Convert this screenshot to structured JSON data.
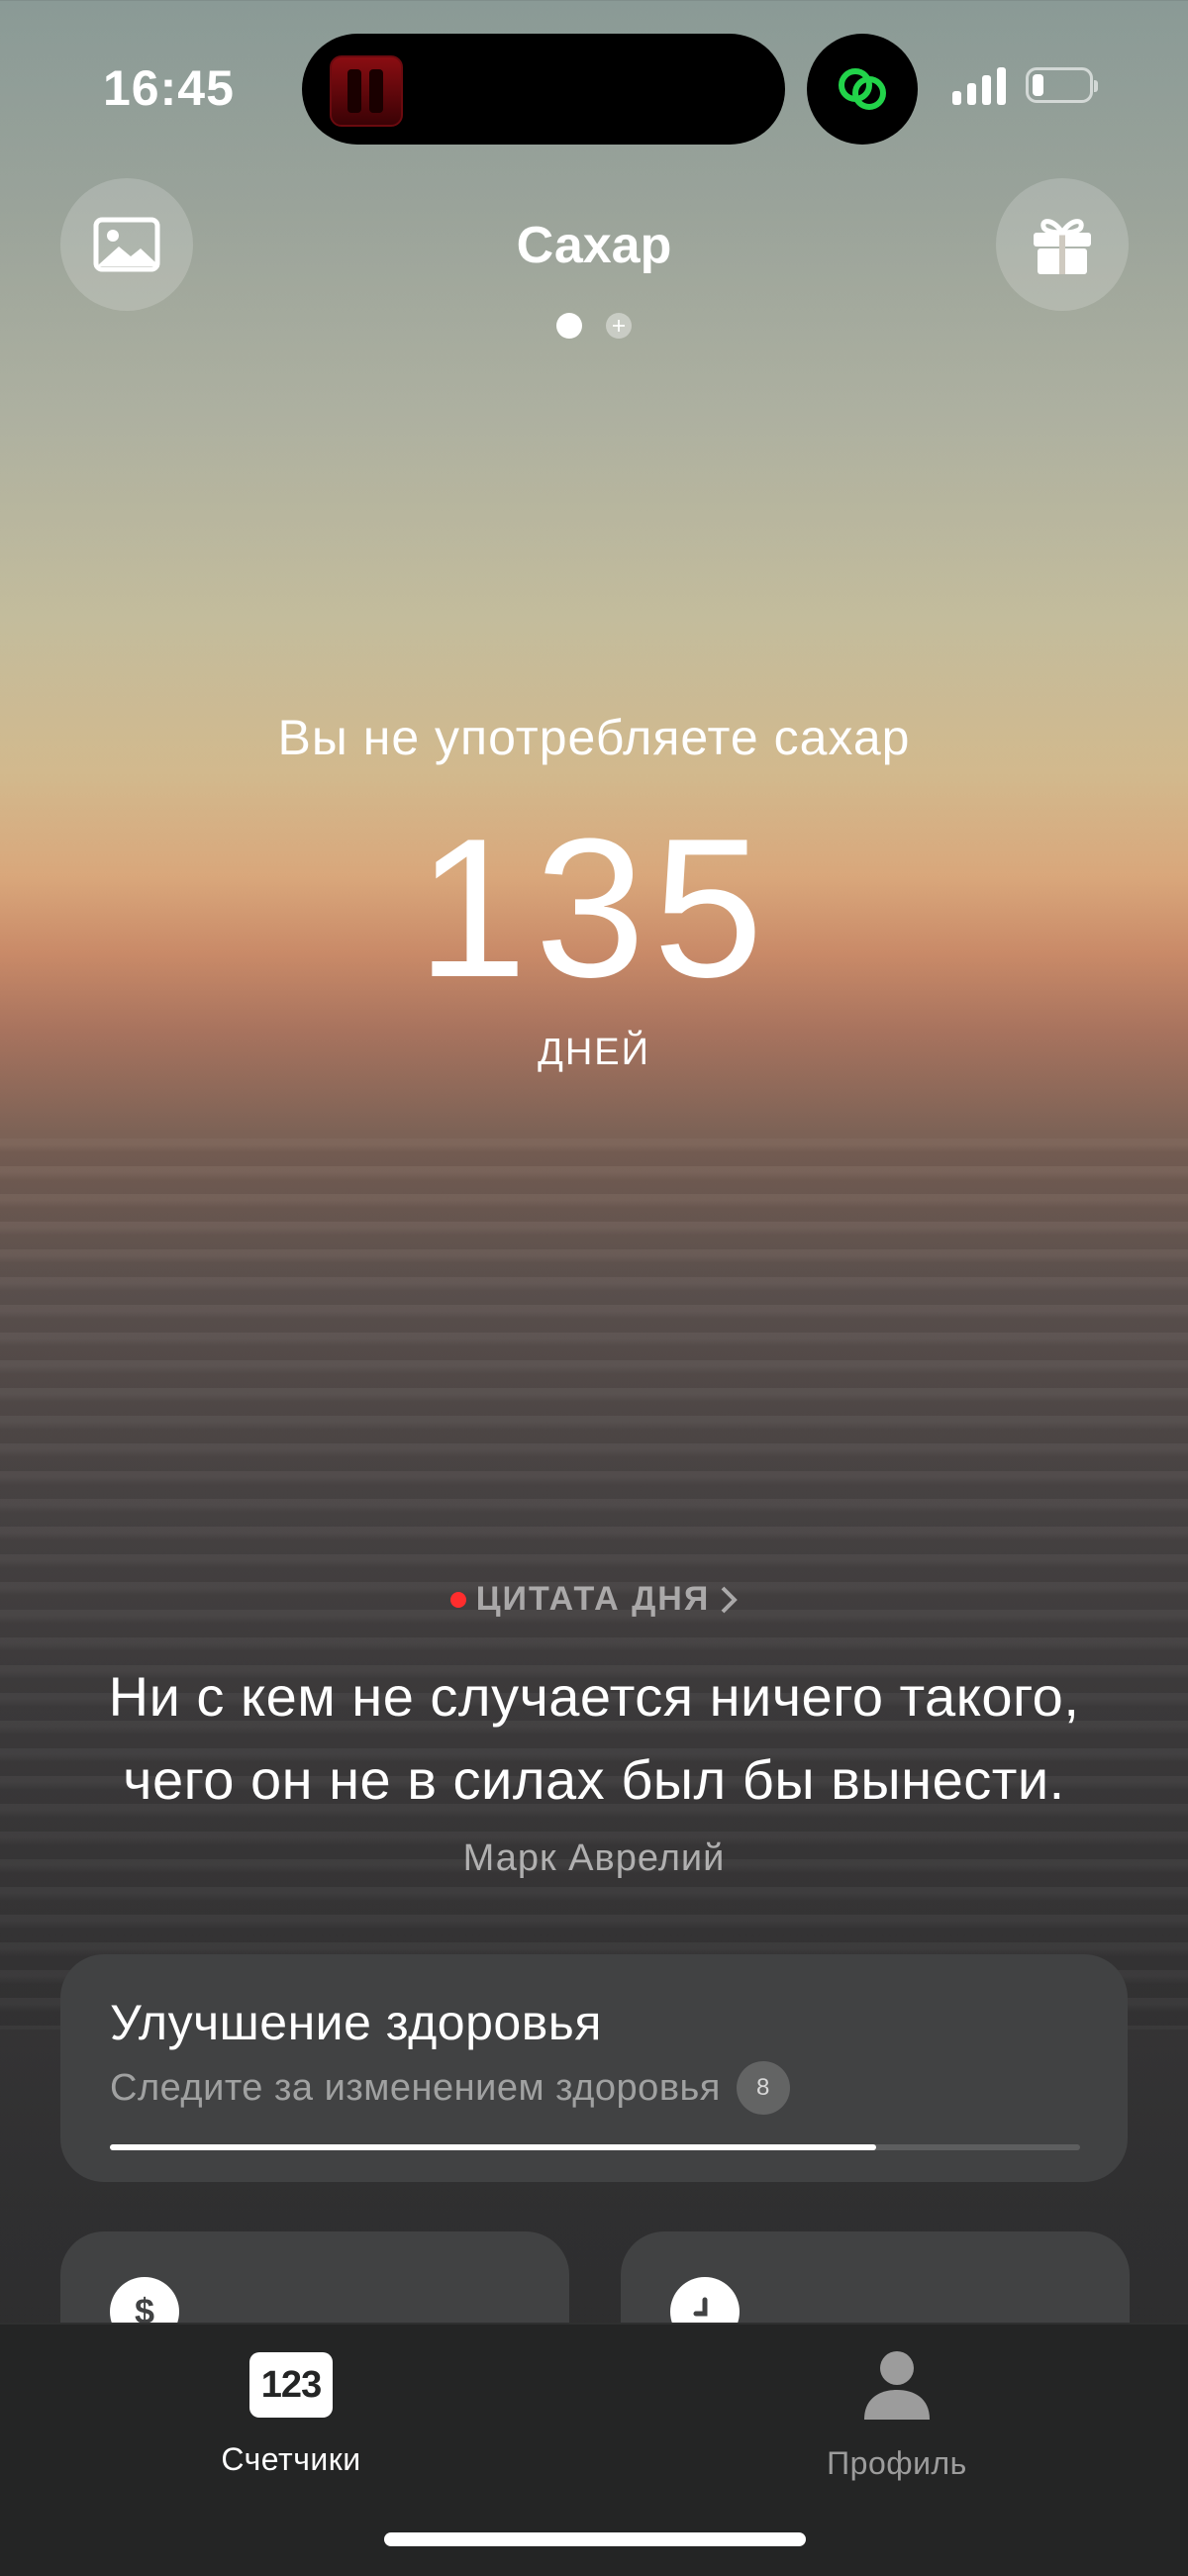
{
  "status_bar": {
    "time": "16:45",
    "battery_level": 0.2
  },
  "header": {
    "title": "Сахар",
    "left_icon": "image-icon",
    "right_icon": "gift-icon",
    "page_dots": [
      "active",
      "add"
    ]
  },
  "counter": {
    "caption": "Вы не употребляете сахар",
    "value": "135",
    "unit": "ДНЕЙ"
  },
  "quote": {
    "label": "ЦИТАТА ДНЯ",
    "label_dot_color": "#ff2d2d",
    "line1": "Ни с кем не случается ничего такого,",
    "line2": "чего он не в силах был бы вынести.",
    "author": "Марк Аврелий"
  },
  "health_card": {
    "title": "Улучшение здоровья",
    "subtitle": "Следите за изменением здоровья",
    "badge": "8",
    "progress": 0.79
  },
  "mini_cards": [
    {
      "icon": "dollar-icon"
    },
    {
      "icon": "clock-icon"
    }
  ],
  "tabs": [
    {
      "label": "Счетчики",
      "icon_text": "123",
      "active": true
    },
    {
      "label": "Профиль",
      "icon": "person-icon",
      "active": false
    }
  ]
}
